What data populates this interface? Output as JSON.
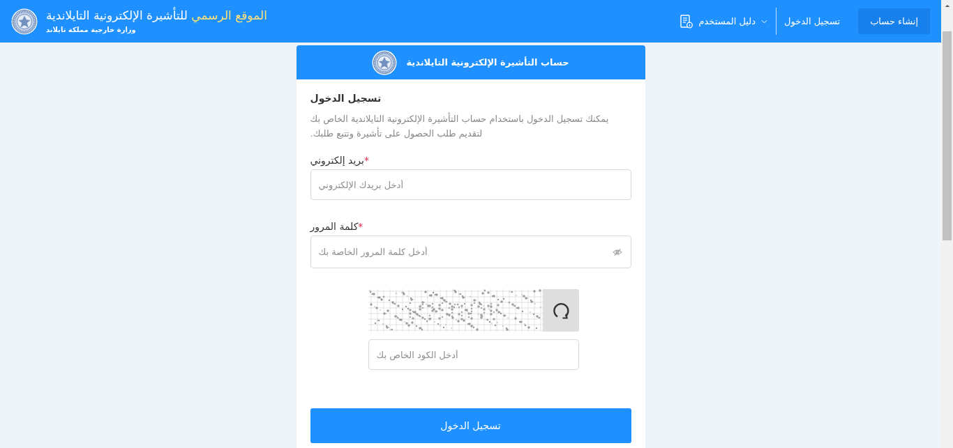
{
  "header": {
    "title": {
      "highlight": "الموقع الرسمي",
      "rest": "للتأشيرة الإلكترونية التايلاندية"
    },
    "subtitle": "وزارة خارجية مملكة تايلاند",
    "nav": [
      {
        "kind": "button",
        "label": "إنشاء حساب"
      },
      {
        "kind": "link",
        "label": "تسجيل الدخول"
      },
      {
        "kind": "menu",
        "label": "دليل المستخدم"
      }
    ]
  },
  "card": {
    "title": "حساب التأشيرة الإلكترونية التايلاندية",
    "heading": "تسجيل الدخول",
    "description": "يمكنك تسجيل الدخول باستخدام حساب التأشيرة الإلكترونية التايلاندية الخاص بك لتقديم طلب الحصول على تأشيرة وتتبع طلبك.",
    "fields": [
      {
        "kind": "email",
        "label": "بريد إلكتروني",
        "required_mark": "*",
        "placeholder": "أدخل بريدك الإلكتروني"
      },
      {
        "kind": "password",
        "label": "كلمة المرور",
        "required_mark": "*",
        "placeholder": "أدخل كلمة المرور الخاصة بك"
      }
    ],
    "captcha": {
      "placeholder": "أدخل الكود الخاص بك"
    },
    "submit": "تسجيل الدخول"
  }
}
